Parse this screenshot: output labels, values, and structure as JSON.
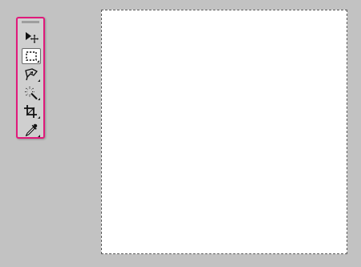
{
  "colors": {
    "workspace_bg": "#c2c2c2",
    "toolbar_bg": "#cfcfcf",
    "toolbar_highlight_border": "#e0197b",
    "canvas_bg": "#ffffff",
    "selection_marquee": "#5a5a5a"
  },
  "toolbar": {
    "tools": [
      {
        "id": "move",
        "icon": "move-icon",
        "active": false,
        "has_flyout": false
      },
      {
        "id": "rectangular-marquee",
        "icon": "rectangular-marquee-icon",
        "active": true,
        "has_flyout": true
      },
      {
        "id": "lasso",
        "icon": "polygonal-lasso-icon",
        "active": false,
        "has_flyout": true
      },
      {
        "id": "magic-wand",
        "icon": "magic-wand-icon",
        "active": false,
        "has_flyout": true
      },
      {
        "id": "crop",
        "icon": "crop-icon",
        "active": false,
        "has_flyout": true
      },
      {
        "id": "eyedropper",
        "icon": "eyedropper-icon",
        "active": false,
        "has_flyout": true
      }
    ]
  },
  "canvas": {
    "selection": "all"
  }
}
